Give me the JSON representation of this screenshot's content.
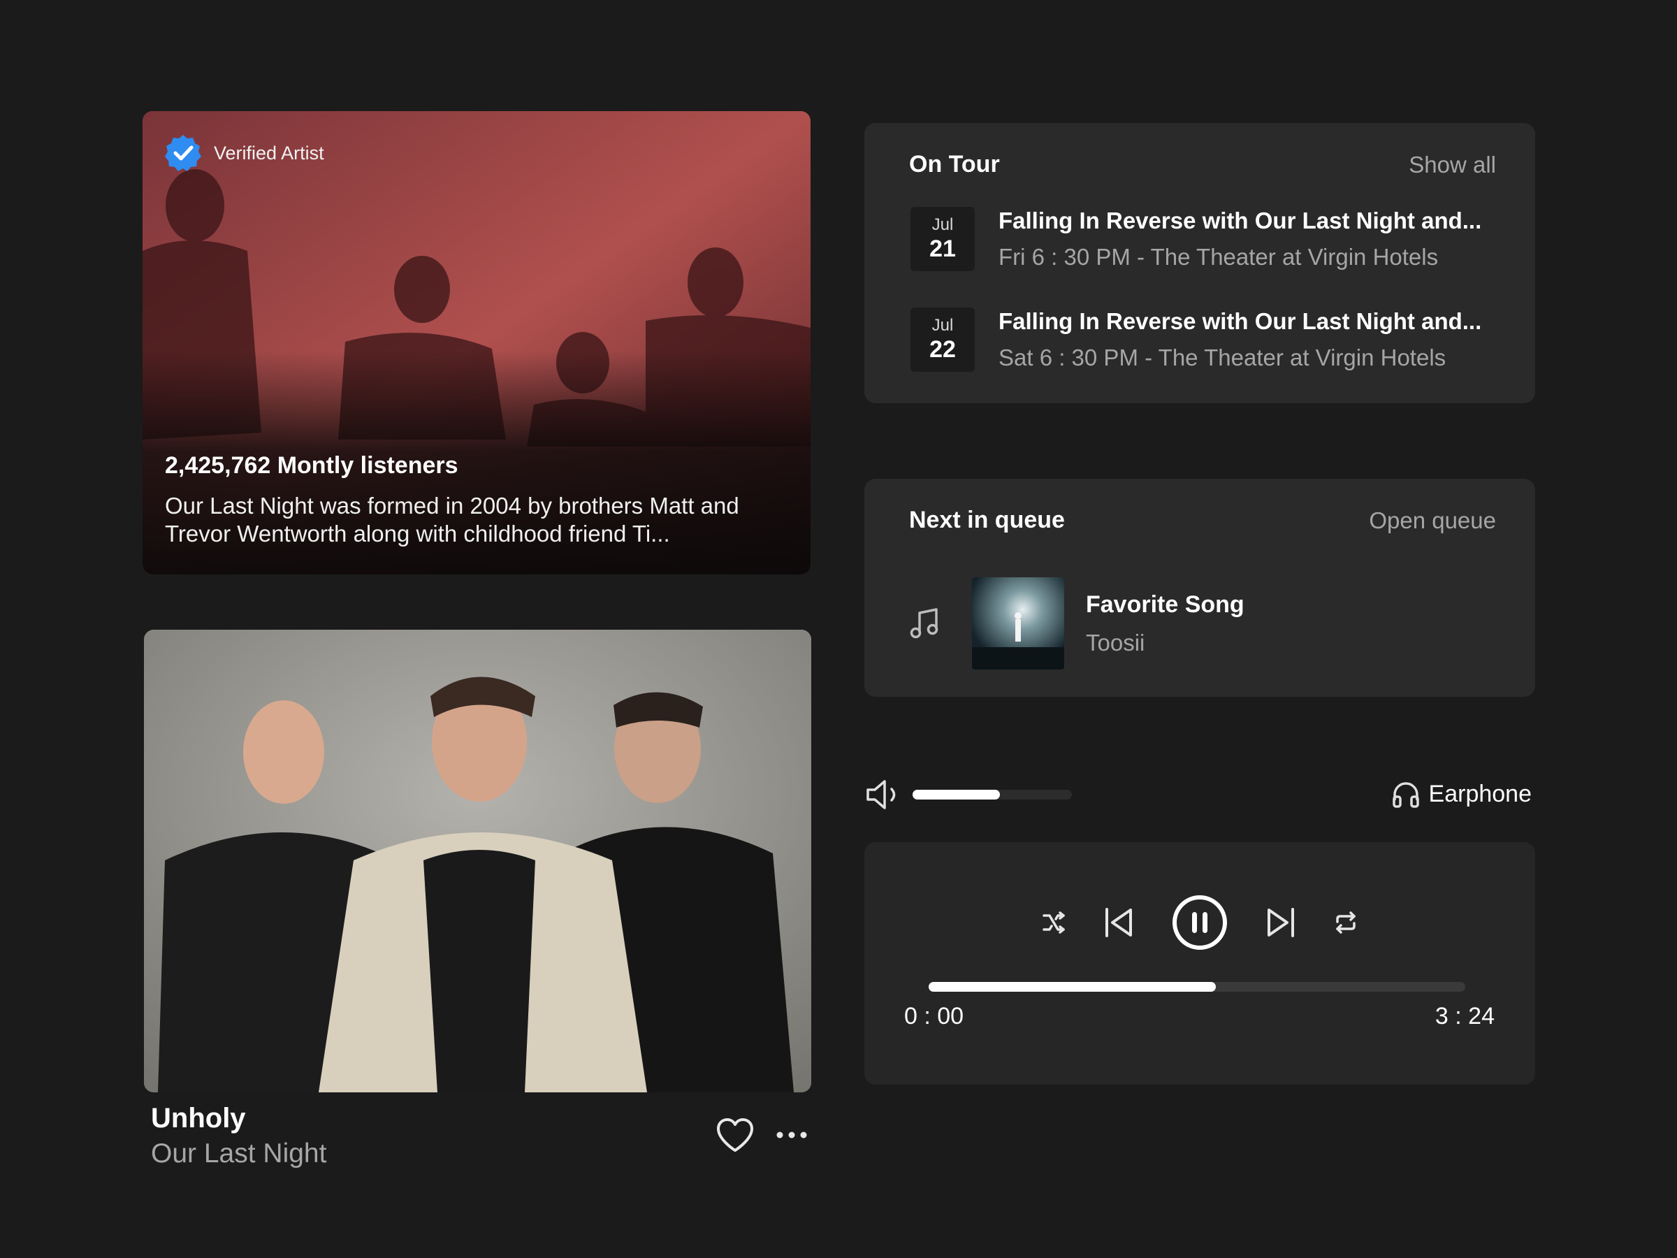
{
  "artist_card": {
    "verified_label": "Verified Artist",
    "listeners": "2,425,762 Montly listeners",
    "bio": "Our Last Night was formed in 2004 by brothers Matt and Trevor Wentworth along with childhood friend Ti..."
  },
  "now_playing": {
    "title": "Unholy",
    "artist": "Our Last Night",
    "icons": [
      "heart-icon",
      "more-icon"
    ]
  },
  "tour": {
    "title": "On Tour",
    "show_all": "Show all",
    "events": [
      {
        "month": "Jul",
        "day": "21",
        "title": "Falling In Reverse with Our Last Night and...",
        "details": "Fri 6 : 30 PM - The Theater at Virgin Hotels"
      },
      {
        "month": "Jul",
        "day": "22",
        "title": "Falling In Reverse with Our Last Night and...",
        "details": "Sat 6 : 30 PM - The Theater at Virgin Hotels"
      }
    ]
  },
  "queue": {
    "title": "Next in queue",
    "open_link": "Open queue",
    "next": {
      "title": "Favorite Song",
      "artist": "Toosii"
    }
  },
  "output": {
    "volume_level": 0.55,
    "device_label": "Earphone"
  },
  "player": {
    "current_time": "0 : 00",
    "total_time": "3 : 24",
    "progress": 0.535,
    "controls": [
      "shuffle-icon",
      "previous-icon",
      "pause-icon",
      "next-icon",
      "repeat-icon"
    ]
  },
  "colors": {
    "background": "#1b1b1b",
    "panel": "#2a2a2a",
    "muted_text": "#a6a6a6",
    "verified_badge": "#2f8cf0",
    "artist_tint": "#6d2f33"
  }
}
